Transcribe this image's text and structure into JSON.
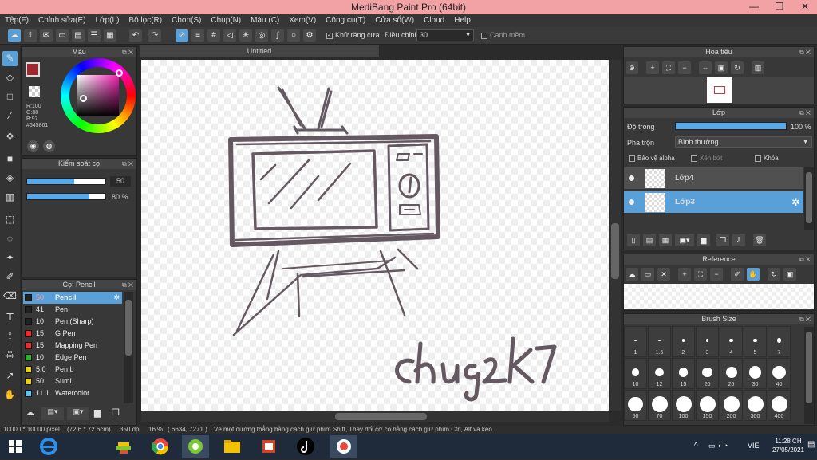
{
  "window": {
    "title": "MediBang Paint Pro (64bit)",
    "minimize": "—",
    "restore": "❐",
    "close": "✕"
  },
  "menu": [
    "Tệp(F)",
    "Chỉnh sửa(E)",
    "Lớp(L)",
    "Bộ lọc(R)",
    "Chọn(S)",
    "Chụp(N)",
    "Màu (C)",
    "Xem(V)",
    "Công cụ(T)",
    "Cửa sổ(W)",
    "Cloud",
    "Help"
  ],
  "toolbar": {
    "antialias_label": "Khử răng cưa",
    "adjust_label": "Điều chỉnh",
    "adjust_value": "30",
    "smooth_label": "Canh mềm"
  },
  "color_panel": {
    "title": "Màu",
    "r": "R:100",
    "g": "G:88",
    "b": "B:97",
    "hex": "#645861",
    "primary_color": "#9b2a2e"
  },
  "brush_control": {
    "title": "Kiểm soát cọ",
    "size_value": "50",
    "size_fraction": 0.6,
    "opacity_value": "80 %",
    "opacity_fraction": 0.8
  },
  "brush_list": {
    "title": "Cọ: Pencil",
    "items": [
      {
        "size": "50",
        "name": "Pencil",
        "color": "#222222",
        "selected": true
      },
      {
        "size": "41",
        "name": "Pen",
        "color": "#222222"
      },
      {
        "size": "10",
        "name": "Pen (Sharp)",
        "color": "#222222"
      },
      {
        "size": "15",
        "name": "G Pen",
        "color": "#e03030"
      },
      {
        "size": "15",
        "name": "Mapping Pen",
        "color": "#e03030"
      },
      {
        "size": "10",
        "name": "Edge Pen",
        "color": "#30b030"
      },
      {
        "size": "5.0",
        "name": " Pen b",
        "color": "#e8d020"
      },
      {
        "size": "50",
        "name": "Sumi",
        "color": "#e8d020"
      },
      {
        "size": "11.1",
        "name": "Watercolor",
        "color": "#60c0f0"
      }
    ]
  },
  "document": {
    "tab": "Untitled",
    "stroke_color": "#645861",
    "signature": "chug2k7"
  },
  "navigator": {
    "title": "Hoa tiêu"
  },
  "layers": {
    "title": "Lớp",
    "opacity_label": "Độ trong",
    "opacity_value": "100 %",
    "opacity_fraction": 1.0,
    "blend_label": "Pha trộn",
    "blend_value": "Bình thường",
    "protect_alpha": "Bảo vệ alpha",
    "clipping": "Xén bớt",
    "lock": "Khóa",
    "items": [
      {
        "name": "Lớp4",
        "selected": false
      },
      {
        "name": "Lớp3",
        "selected": true
      }
    ]
  },
  "reference": {
    "title": "Reference"
  },
  "brush_size": {
    "title": "Brush Size",
    "sizes": [
      "1",
      "1.5",
      "2",
      "3",
      "4",
      "5",
      "7",
      "10",
      "12",
      "15",
      "20",
      "25",
      "30",
      "40",
      "50",
      "70",
      "100",
      "150",
      "200",
      "300",
      "400"
    ]
  },
  "status": {
    "canvas": "10000 * 10000 pixel",
    "physical": "(72.6 * 72.6cm)",
    "dpi": "350 dpi",
    "zoom": "16 %",
    "coords": "( 6634, 7271 )",
    "hint": "Vẽ một đường thẳng bằng cách giữ phím Shift, Thay đổi cỡ cọ bằng cách giữ phím Ctrl, Alt và kéo"
  },
  "taskbar": {
    "lang": "VIE",
    "time": "11:28 CH",
    "date": "27/05/2021"
  }
}
